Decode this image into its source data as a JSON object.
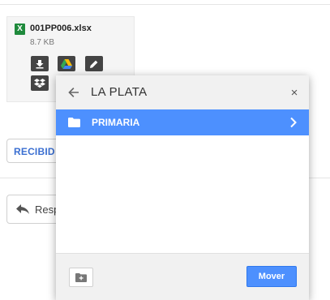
{
  "attachment": {
    "file_badge": "X",
    "file_name": "001PP006.xlsx",
    "file_size": "8.7 KB",
    "actions": [
      "download-icon",
      "google-drive-icon",
      "edit-pencil-icon",
      "dropbox-icon"
    ]
  },
  "label_chip": {
    "text": "RECIBID"
  },
  "reply_button": {
    "label": "Resp"
  },
  "dialog": {
    "title": "LA PLATA",
    "close_glyph": "×",
    "folders": [
      {
        "name": "PRIMARIA"
      }
    ],
    "move_button": "Mover"
  },
  "colors": {
    "accent_blue": "#4d90fe",
    "excel_green": "#1f8a3c",
    "action_button": "#444444",
    "chip_text": "#3b6fd1"
  }
}
